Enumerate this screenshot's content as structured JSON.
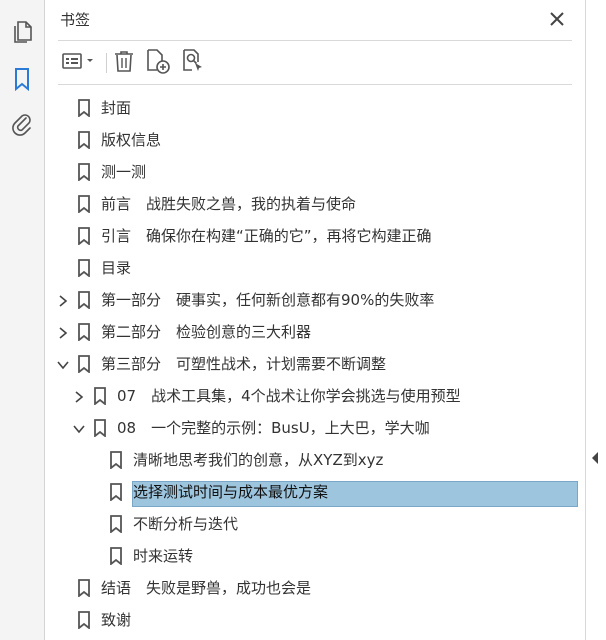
{
  "panel": {
    "title": "书签"
  },
  "colors": {
    "icon_active": "#2b7bd6",
    "icon_default": "#555555",
    "selected_bg": "#9ec5de"
  },
  "rail": {
    "items": [
      {
        "name": "page-thumbnails-icon"
      },
      {
        "name": "bookmarks-icon",
        "active": true
      },
      {
        "name": "attachments-icon"
      }
    ]
  },
  "toolbar": {
    "buttons": [
      "options-menu-icon",
      "delete-icon",
      "new-bookmark-icon",
      "find-bookmark-icon"
    ]
  },
  "bookmarks": [
    {
      "label": "封面",
      "level": 0,
      "expander": "none"
    },
    {
      "label": "版权信息",
      "level": 0,
      "expander": "none"
    },
    {
      "label": "测一测",
      "level": 0,
      "expander": "none"
    },
    {
      "label": "前言　战胜失败之兽，我的执着与使命",
      "level": 0,
      "expander": "none"
    },
    {
      "label": "引言　确保你在构建“正确的它”，再将它构建正确",
      "level": 0,
      "expander": "none"
    },
    {
      "label": "目录",
      "level": 0,
      "expander": "none"
    },
    {
      "label": "第一部分　硬事实，任何新创意都有90%的失败率",
      "level": 0,
      "expander": "collapsed"
    },
    {
      "label": "第二部分　检验创意的三大利器",
      "level": 0,
      "expander": "collapsed"
    },
    {
      "label": "第三部分　可塑性战术，计划需要不断调整",
      "level": 0,
      "expander": "expanded"
    },
    {
      "label": "07　战术工具集，4个战术让你学会挑选与使用预型",
      "level": 1,
      "expander": "collapsed"
    },
    {
      "label": "08　一个完整的示例：BusU，上大巴，学大咖",
      "level": 1,
      "expander": "expanded"
    },
    {
      "label": "清晰地思考我们的创意，从XYZ到xyz",
      "level": 2,
      "expander": "none"
    },
    {
      "label": "选择测试时间与成本最优方案",
      "level": 2,
      "expander": "none",
      "selected": true
    },
    {
      "label": "不断分析与迭代",
      "level": 2,
      "expander": "none"
    },
    {
      "label": "时来运转",
      "level": 2,
      "expander": "none"
    },
    {
      "label": "结语　失败是野兽，成功也会是",
      "level": 0,
      "expander": "none"
    },
    {
      "label": "致谢",
      "level": 0,
      "expander": "none"
    }
  ]
}
